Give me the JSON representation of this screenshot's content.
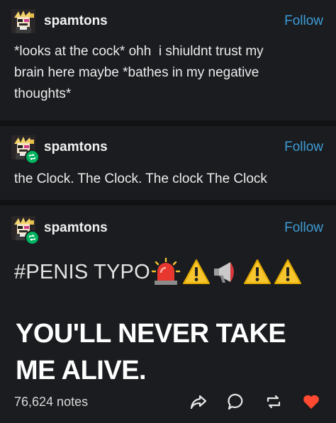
{
  "colors": {
    "background": "#101214",
    "post_background": "#1a1c1f",
    "follow_link": "#3d9bd6",
    "reblog_badge": "#00b35f",
    "like_heart": "#ff4930"
  },
  "posts": [
    {
      "username": "spamtons",
      "follow_label": "Follow",
      "text": "*looks at the cock* ohh  i shiuldnt trust my\nbrain here maybe *bathes in my negative\nthoughts*",
      "avatar_icon": "spamton-avatar-icon"
    },
    {
      "username": "spamtons",
      "follow_label": "Follow",
      "text": "the Clock. The Clock. The clock The Clock",
      "avatar_icon": "spamton-avatar-icon",
      "badge_icon": "reblog-badge-icon"
    },
    {
      "username": "spamtons",
      "follow_label": "Follow",
      "tag_text": "#PENIS TYPO",
      "tag_emojis": [
        "police-light-icon",
        "warning-icon",
        "megaphone-icon",
        "warning-icon",
        "warning-icon"
      ],
      "big_text": "YOU'LL NEVER TAKE ME ALIVE.",
      "avatar_icon": "spamton-avatar-icon",
      "badge_icon": "reblog-badge-icon"
    }
  ],
  "footer": {
    "notes": "76,624 notes",
    "actions": [
      "share-icon",
      "reply-icon",
      "reblog-icon",
      "like-icon"
    ]
  }
}
